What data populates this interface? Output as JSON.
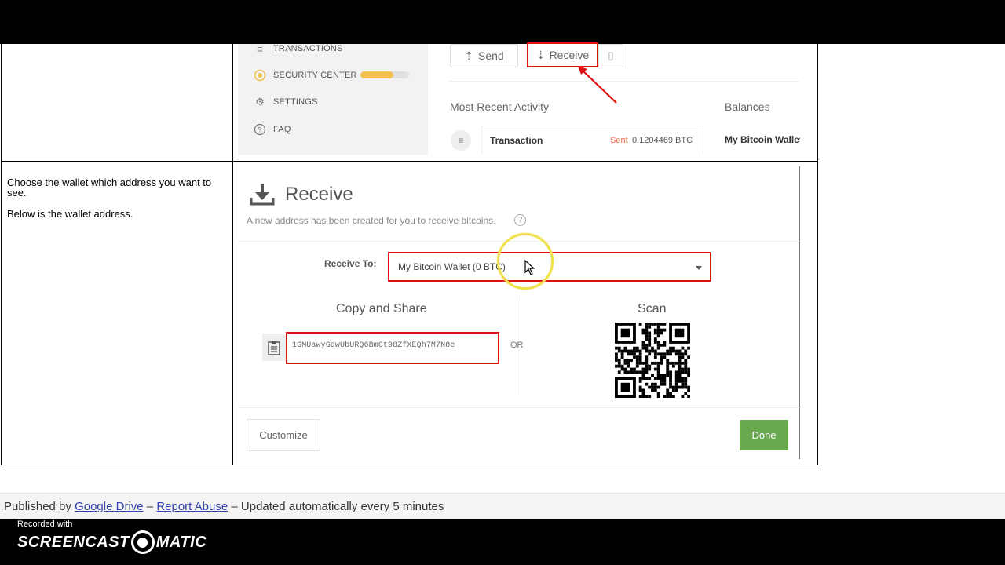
{
  "sidebar": {
    "items": [
      {
        "label": "TRANSACTIONS",
        "icon": "list-icon"
      },
      {
        "label": "SECURITY CENTER",
        "icon": "shield-icon",
        "progress": 0.68
      },
      {
        "label": "SETTINGS",
        "icon": "gear-icon"
      },
      {
        "label": "FAQ",
        "icon": "question-icon"
      }
    ]
  },
  "toolbar": {
    "send_label": "Send",
    "receive_label": "Receive"
  },
  "activity": {
    "heading": "Most Recent Activity",
    "balances_heading": "Balances",
    "tx_name": "Transaction",
    "tx_sent": "Sent",
    "tx_amount": "0.1204469 BTC",
    "balance_wallet": "My Bitcoin Wallet"
  },
  "instructions": {
    "line1": "Choose the wallet which address you want to see.",
    "line2": "Below is the wallet address."
  },
  "receive": {
    "title": "Receive",
    "subtitle": "A new address has been created for you to receive bitcoins.",
    "receive_to_label": "Receive To:",
    "wallet_selected": "My Bitcoin Wallet  (0 BTC)",
    "copy_title": "Copy and Share",
    "address": "1GMUawyGdwUbURQ6BmCt98ZfXEQh7M7N8e",
    "or_label": "OR",
    "scan_title": "Scan",
    "customize_label": "Customize",
    "done_label": "Done"
  },
  "footer": {
    "published_by": "Published by",
    "google_drive": "Google Drive",
    "dash1": "–",
    "report_abuse": "Report Abuse",
    "dash2": "–",
    "updated": "Updated automatically every 5 minutes"
  },
  "recorder": {
    "recorded_with": "Recorded with",
    "brand_left": "SCREENCAST",
    "brand_right": "MATIC"
  },
  "colors": {
    "highlight_red": "#dd1111",
    "done_green": "#6aa84f",
    "security_bar": "#f2c14e",
    "sent_orange": "#e06a4a"
  }
}
